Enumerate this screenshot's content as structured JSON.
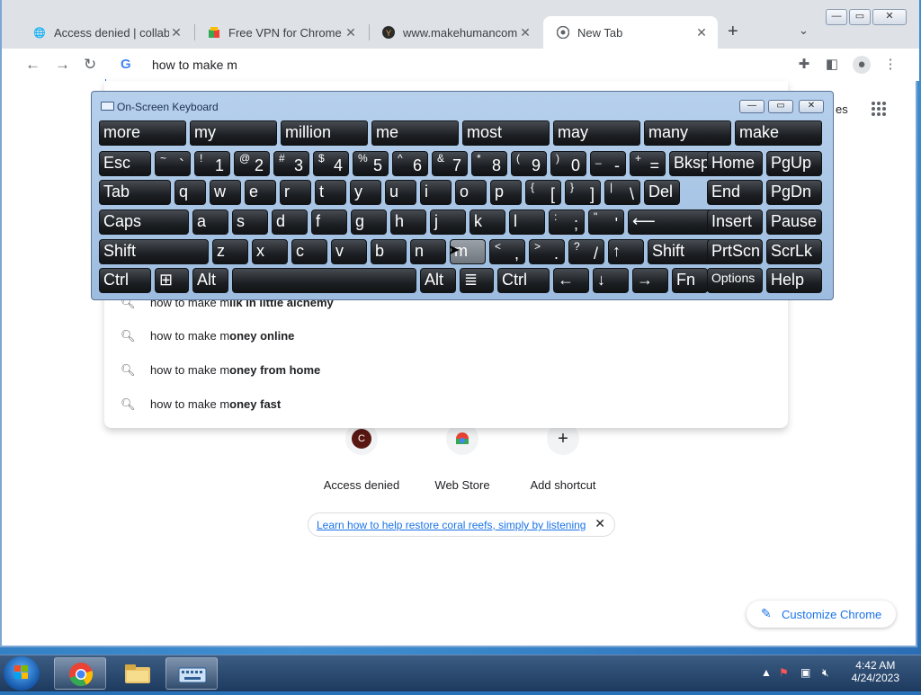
{
  "browser": {
    "tabs": [
      {
        "label": "Access denied | collabvm",
        "icon": "globe-icon"
      },
      {
        "label": "Free VPN for Chrome by",
        "icon": "chrome-webstore-icon"
      },
      {
        "label": "www.makehumancomm",
        "icon": "makehuman-icon"
      },
      {
        "label": "New Tab",
        "icon": "chrome-icon"
      }
    ],
    "omnibox_text": "how to make m",
    "partial_right_text": "es"
  },
  "keyboard": {
    "title": "On-Screen Keyboard",
    "predictions": [
      "more",
      "my",
      "million",
      "me",
      "most",
      "may",
      "many",
      "make"
    ],
    "row1": [
      {
        "m": "Esc"
      },
      {
        "s": "~",
        "b": "`"
      },
      {
        "s": "!",
        "b": "1"
      },
      {
        "s": "@",
        "b": "2"
      },
      {
        "s": "#",
        "b": "3"
      },
      {
        "s": "$",
        "b": "4"
      },
      {
        "s": "%",
        "b": "5"
      },
      {
        "s": "^",
        "b": "6"
      },
      {
        "s": "&",
        "b": "7"
      },
      {
        "s": "*",
        "b": "8"
      },
      {
        "s": "(",
        "b": "9"
      },
      {
        "s": ")",
        "b": "0"
      },
      {
        "s": "_",
        "b": "-"
      },
      {
        "s": "+",
        "b": "="
      },
      {
        "m": "Bksp"
      },
      {
        "m": "Home"
      },
      {
        "m": "PgUp"
      }
    ],
    "row2": [
      {
        "m": "Tab"
      },
      {
        "m": "q"
      },
      {
        "m": "w"
      },
      {
        "m": "e"
      },
      {
        "m": "r"
      },
      {
        "m": "t"
      },
      {
        "m": "y"
      },
      {
        "m": "u"
      },
      {
        "m": "i"
      },
      {
        "m": "o"
      },
      {
        "m": "p"
      },
      {
        "s": "{",
        "b": "["
      },
      {
        "s": "}",
        "b": "]"
      },
      {
        "s": "|",
        "b": "\\"
      },
      {
        "m": "Del"
      },
      {
        "m": "End"
      },
      {
        "m": "PgDn"
      }
    ],
    "row3": [
      {
        "m": "Caps"
      },
      {
        "m": "a"
      },
      {
        "m": "s"
      },
      {
        "m": "d"
      },
      {
        "m": "f"
      },
      {
        "m": "g"
      },
      {
        "m": "h"
      },
      {
        "m": "j"
      },
      {
        "m": "k"
      },
      {
        "m": "l"
      },
      {
        "s": ":",
        "b": ";"
      },
      {
        "s": "\"",
        "b": "'"
      },
      {
        "m": "⟵"
      },
      {
        "m": "Insert"
      },
      {
        "m": "Pause"
      }
    ],
    "row4": [
      {
        "m": "Shift"
      },
      {
        "m": "z"
      },
      {
        "m": "x"
      },
      {
        "m": "c"
      },
      {
        "m": "v"
      },
      {
        "m": "b"
      },
      {
        "m": "n"
      },
      {
        "m": "m"
      },
      {
        "s": "<",
        "b": ","
      },
      {
        "s": ">",
        "b": "."
      },
      {
        "s": "?",
        "b": "/"
      },
      {
        "m": "↑"
      },
      {
        "m": "Shift"
      },
      {
        "m": "PrtScn"
      },
      {
        "m": "ScrLk"
      }
    ],
    "row5": [
      {
        "m": "Ctrl"
      },
      {
        "m": "⊞"
      },
      {
        "m": "Alt"
      },
      {
        "m": ""
      },
      {
        "m": "Alt"
      },
      {
        "m": "≣"
      },
      {
        "m": "Ctrl"
      },
      {
        "m": "←"
      },
      {
        "m": "↓"
      },
      {
        "m": "→"
      },
      {
        "m": "Fn"
      },
      {
        "m": "Options"
      },
      {
        "m": "Help"
      }
    ]
  },
  "suggestions": [
    {
      "prefix": "how to make m",
      "suffix": "ilk in little alchemy"
    },
    {
      "prefix": "how to make m",
      "suffix": "oney online"
    },
    {
      "prefix": "how to make m",
      "suffix": "oney from home"
    },
    {
      "prefix": "how to make m",
      "suffix": "oney fast"
    }
  ],
  "shortcuts": [
    {
      "label": "Access denied",
      "glyph": "C"
    },
    {
      "label": "Web Store",
      "glyph": ""
    },
    {
      "label": "Add shortcut",
      "glyph": "+"
    }
  ],
  "promo": {
    "text": "Learn how to help restore coral reefs, simply by listening"
  },
  "customize": {
    "label": "Customize Chrome"
  },
  "taskbar": {
    "time": "4:42 AM",
    "date": "4/24/2023"
  }
}
